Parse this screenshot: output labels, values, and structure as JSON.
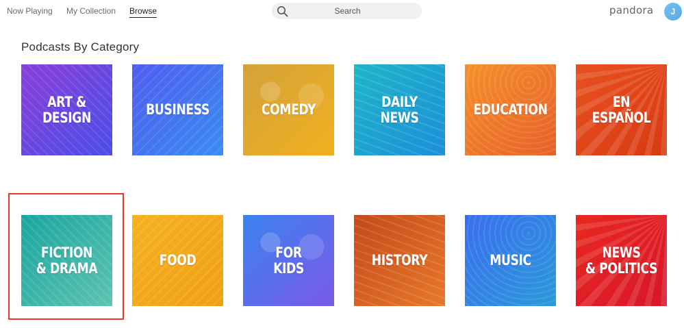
{
  "nav": {
    "items": [
      {
        "label": "Now Playing"
      },
      {
        "label": "My Collection"
      },
      {
        "label": "Browse"
      }
    ]
  },
  "search": {
    "placeholder": "Search",
    "value": ""
  },
  "brand": {
    "logo_text": "pandora",
    "avatar_initial": "J"
  },
  "section": {
    "title": "Podcasts By Category"
  },
  "categories": [
    {
      "label": "ART &\nDESIGN",
      "colors": [
        "#8a3fd8",
        "#4a4ee8"
      ]
    },
    {
      "label": "BUSINESS",
      "colors": [
        "#4f5cf0",
        "#3b8cf2"
      ]
    },
    {
      "label": "COMEDY",
      "colors": [
        "#d4a23a",
        "#f0b020"
      ]
    },
    {
      "label": "DAILY\nNEWS",
      "colors": [
        "#1fb6c8",
        "#1b8fd8"
      ]
    },
    {
      "label": "EDUCATION",
      "colors": [
        "#f5902a",
        "#e8602a"
      ]
    },
    {
      "label": "EN ESPAÑOL",
      "colors": [
        "#e8501f",
        "#d83a12"
      ]
    },
    {
      "label": "FICTION\n& DRAMA",
      "colors": [
        "#1aa6a0",
        "#5ec3b0"
      ]
    },
    {
      "label": "FOOD",
      "colors": [
        "#f5b220",
        "#f0a015"
      ]
    },
    {
      "label": "FOR\nKIDS",
      "colors": [
        "#3b82f0",
        "#7a5ae8"
      ]
    },
    {
      "label": "HISTORY",
      "colors": [
        "#c44a1a",
        "#e8782a"
      ]
    },
    {
      "label": "MUSIC",
      "colors": [
        "#3b6ef0",
        "#2a9ad8"
      ]
    },
    {
      "label": "NEWS\n& POLITICS",
      "colors": [
        "#e8281f",
        "#d8162a"
      ]
    }
  ],
  "icons": {
    "search": "search-icon"
  }
}
